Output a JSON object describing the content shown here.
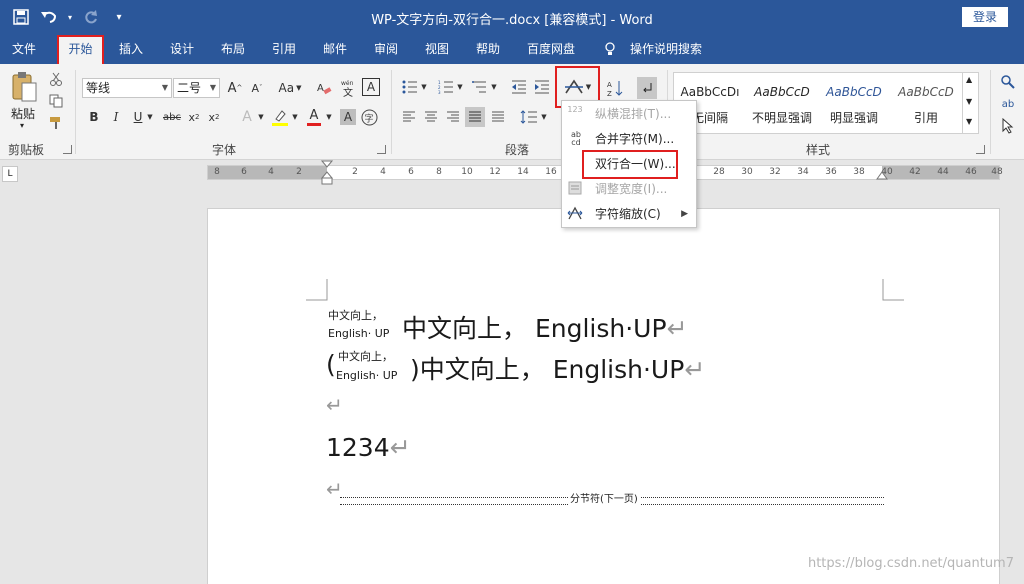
{
  "window": {
    "title": "WP-文字方向-双行合一.docx [兼容模式]  -  Word",
    "login": "登录"
  },
  "tabs": [
    "文件",
    "开始",
    "插入",
    "设计",
    "布局",
    "引用",
    "邮件",
    "审阅",
    "视图",
    "帮助",
    "百度网盘",
    "操作说明搜索"
  ],
  "ribbon": {
    "clipboard": {
      "paste": "粘贴",
      "label": "剪贴板"
    },
    "font": {
      "name": "等线",
      "size": "二号",
      "label": "字体",
      "change_case": "Aa"
    },
    "paragraph": {
      "label": "段落"
    },
    "styles": {
      "label": "样式",
      "items": [
        {
          "sample": "AaBbCcDı",
          "name": "无间隔"
        },
        {
          "sample": "AaBbCcD",
          "name": "不明显强调"
        },
        {
          "sample": "AaBbCcD",
          "name": "明显强调"
        },
        {
          "sample": "AaBbCcD",
          "name": "引用"
        }
      ]
    }
  },
  "ruler": {
    "left_ticks": [
      "8",
      "6",
      "4",
      "2"
    ],
    "right_ticks": [
      "2",
      "4",
      "6",
      "8",
      "10",
      "12",
      "14",
      "16",
      "28",
      "30",
      "32",
      "34",
      "36",
      "38",
      "40",
      "42",
      "44",
      "46",
      "48"
    ]
  },
  "menu": {
    "items": [
      {
        "icon": "123",
        "label": "纵横混排(T)...",
        "disabled": true
      },
      {
        "icon": "ab cd",
        "label": "合并字符(M)...",
        "disabled": false
      },
      {
        "icon": "",
        "label": "双行合一(W)...",
        "disabled": false
      },
      {
        "icon": "",
        "label": "调整宽度(I)...",
        "disabled": true
      },
      {
        "icon": "",
        "label": "字符缩放(C)",
        "disabled": false
      }
    ]
  },
  "document": {
    "line1_small_top": "中文向上，",
    "line1_small_bottom": "English· UP",
    "line1_main": "中文向上， English·UP",
    "line2_open": "(",
    "line2_small_top": "中文向上，",
    "line2_small_bottom": "English· UP",
    "line2_close_main": ")中文向上， English·UP",
    "line4": "1234",
    "section_break": "分节符(下一页)",
    "para_mark": "↵"
  },
  "watermark": "https://blog.csdn.net/quantum7"
}
